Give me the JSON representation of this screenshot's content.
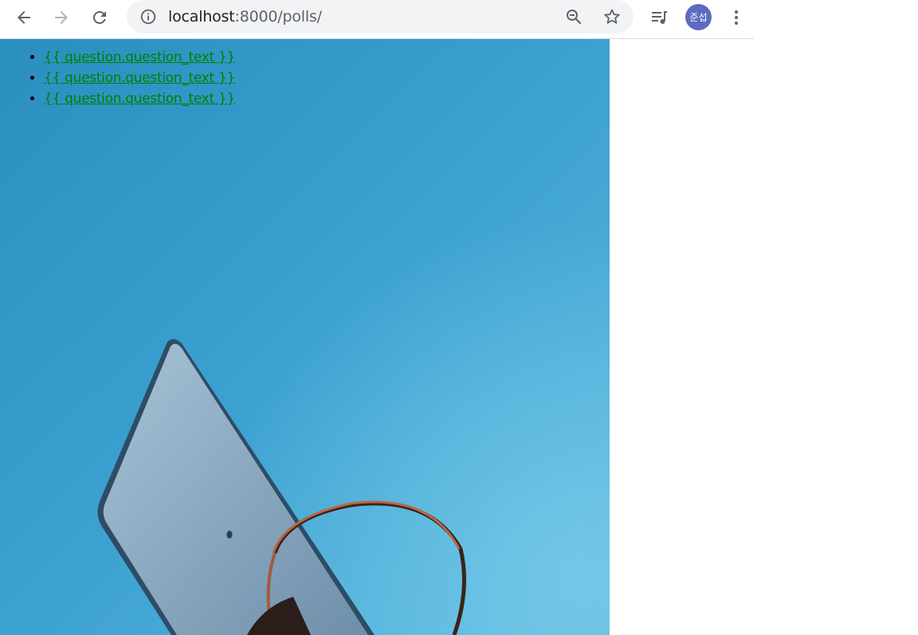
{
  "browser": {
    "url_host": "localhost",
    "url_path": ":8000/polls/",
    "icons": {
      "back": "arrow-left-icon",
      "forward": "arrow-right-icon",
      "reload": "reload-icon",
      "site_info": "info-icon",
      "zoom": "zoom-out-icon",
      "bookmark": "star-icon",
      "media": "media-queue-icon",
      "menu": "kebab-menu-icon"
    },
    "profile_initials": "준섭",
    "profile_color": "#5c6bc0"
  },
  "page": {
    "questions": [
      {
        "text": "{{ question.question_text }}"
      },
      {
        "text": "{{ question.question_text }}"
      },
      {
        "text": "{{ question.question_text }}"
      }
    ],
    "link_color": "#008000",
    "background_image": "basketball-hoop-against-blue-sky"
  }
}
